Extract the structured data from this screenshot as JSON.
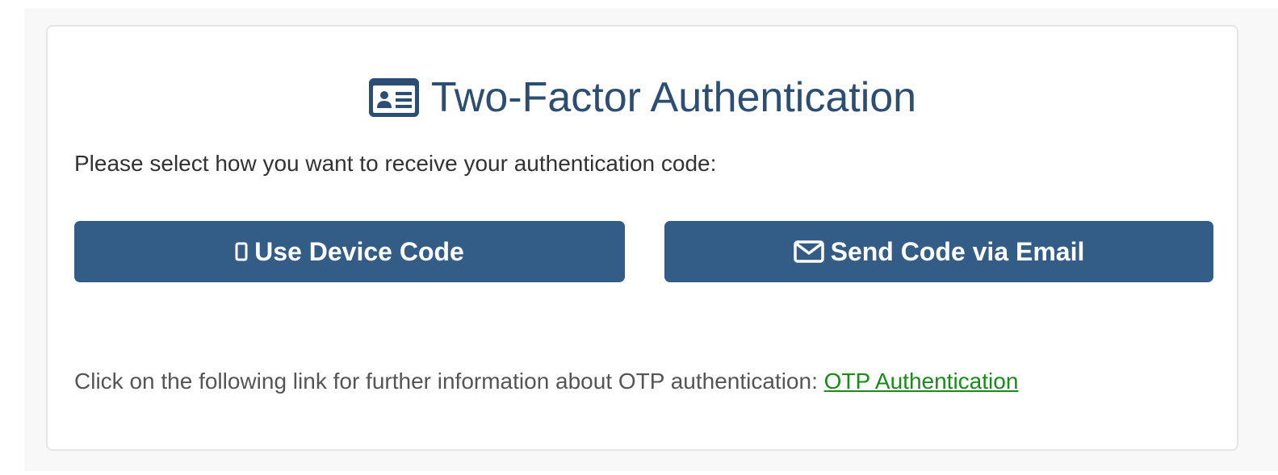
{
  "header": {
    "icon": "id-card-icon",
    "title": "Two-Factor Authentication"
  },
  "prompt": "Please select how you want to receive your authentication code:",
  "buttons": {
    "device": {
      "icon": "mobile-phone-icon",
      "label": "Use Device Code"
    },
    "email": {
      "icon": "envelope-icon",
      "label": "Send Code via Email"
    }
  },
  "footer": {
    "text": "Click on the following link for further information about OTP authentication: ",
    "link_label": "OTP Authentication"
  },
  "colors": {
    "title": "#2c4e72",
    "button_bg": "#335d87",
    "link": "#1a8a1a"
  }
}
